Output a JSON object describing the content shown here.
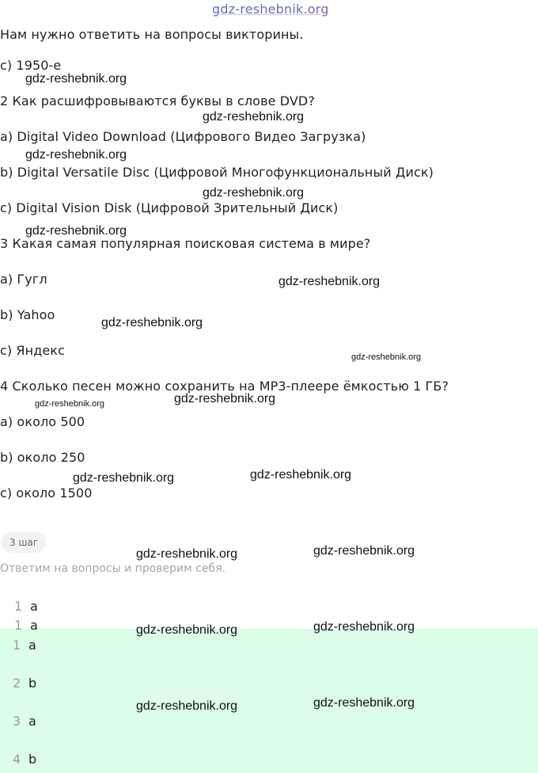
{
  "site": "gdz-reshebnik.org",
  "lines": [
    "Нам нужно ответить на вопросы викторины.",
    "c) 1950-е",
    "2 Как расшифровываются буквы в слове DVD?",
    "a) Digital Video Download (Цифрового Видео Загрузка)",
    "b) Digital Versatile Disc (Цифровой Многофункциональный Диск)",
    "c) Digital Vision Disk (Цифровой Зрительный Диск)",
    "3 Какая самая популярная поисковая система в мире?",
    "a) Гугл",
    "b) Yahoo",
    "c) Яндекс",
    "4 Сколько песен можно сохранить на MP3-плеере ёмкостью 1 ГБ?",
    "a) около 500",
    "b) около 250",
    "c) около 1500"
  ],
  "step": {
    "badge": "3 шаг",
    "description": "Ответим на вопросы и проверим себя."
  },
  "answers": [
    {
      "num": "1",
      "value": "a"
    },
    {
      "num": "1",
      "value": "a"
    },
    {
      "num": "1",
      "value": "a"
    },
    {
      "num": "2",
      "value": "b"
    },
    {
      "num": "3",
      "value": "a"
    },
    {
      "num": "4",
      "value": "b"
    }
  ]
}
